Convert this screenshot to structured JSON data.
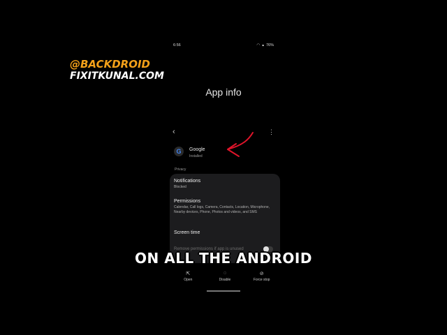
{
  "status_bar": {
    "time": "6:56",
    "battery": "76%"
  },
  "watermark": {
    "line1": "@BACKDROID",
    "line2": "FIXITKUNAL.COM"
  },
  "header": {
    "title": "App info"
  },
  "app": {
    "name": "Google",
    "status": "Installed"
  },
  "section": {
    "privacy": "Privacy"
  },
  "items": [
    {
      "title": "Notifications",
      "subtitle": "Blocked"
    },
    {
      "title": "Permissions",
      "subtitle": "Calendar, Call logs, Camera, Contacts, Location, Microphone, Nearby devices, Phone, Photos and videos, and SMS"
    },
    {
      "title": "Screen time",
      "subtitle": ""
    }
  ],
  "toggle": {
    "label": "Remove permissions if app is unused"
  },
  "caption": {
    "text": "ON ALL THE ANDROID"
  },
  "bottom_bar": {
    "open": "Open",
    "disable": "Disable",
    "force_stop": "Force stop"
  },
  "colors": {
    "watermark_accent": "#f3a019",
    "annotation_arrow": "#e0142a"
  }
}
